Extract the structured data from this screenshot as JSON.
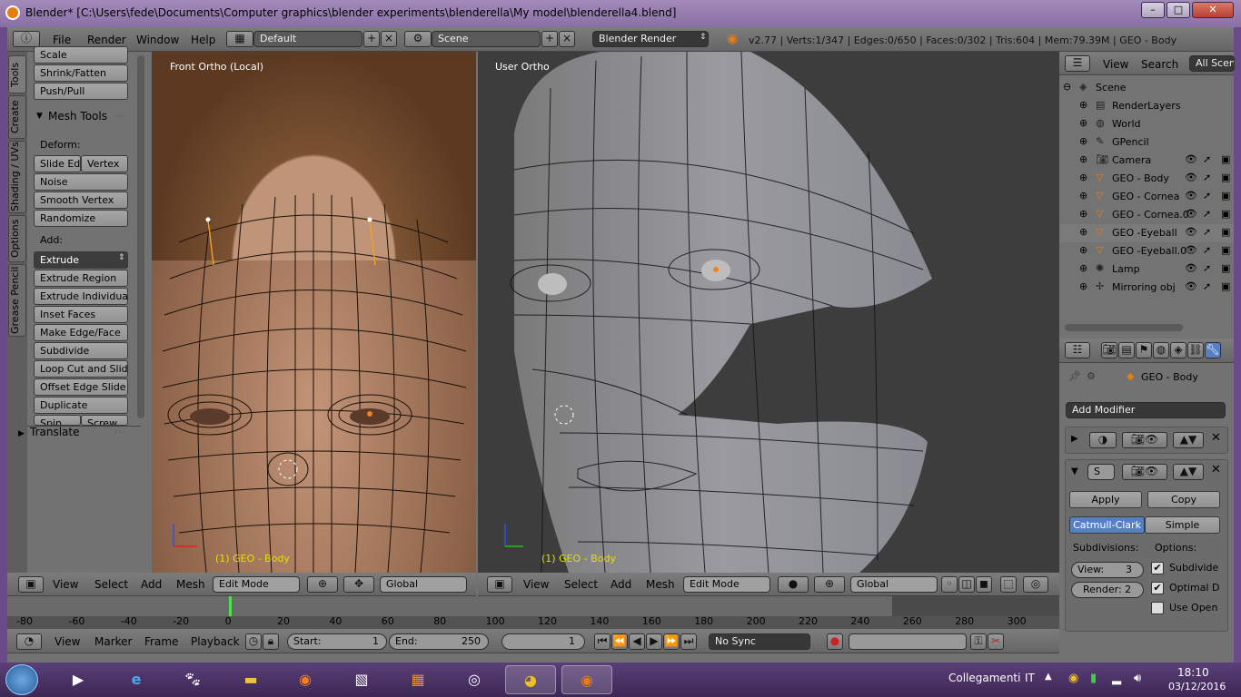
{
  "window": {
    "title": "Blender* [C:\\Users\\fede\\Documents\\Computer graphics\\blender experiments\\blenderella\\My model\\blenderella4.blend]",
    "controls": [
      "–",
      "□",
      "✕"
    ]
  },
  "topbar": {
    "menus": [
      "File",
      "Render",
      "Window",
      "Help"
    ],
    "layout": "Default",
    "scene": "Scene",
    "engine": "Blender Render",
    "stats": "v2.77 | Verts:1/347 | Edges:0/650 | Faces:0/302 | Tris:604 | Mem:79.39M | GEO - Body"
  },
  "toolshelf": {
    "tabs": [
      "Tools",
      "Create",
      "Shading / UVs",
      "Options",
      "Grease Pencil"
    ],
    "top_buttons": [
      "Scale",
      "Shrink/Fatten",
      "Push/Pull"
    ],
    "panel_title": "Mesh Tools",
    "deform_label": "Deform:",
    "deform": {
      "slide_edge": "Slide Ed",
      "vertex": "Vertex",
      "noise": "Noise",
      "smooth_vertex": "Smooth Vertex",
      "randomize": "Randomize"
    },
    "add_label": "Add:",
    "extrude_select": "Extrude",
    "add_buttons": [
      "Extrude Region",
      "Extrude Individual",
      "Inset Faces",
      "Make Edge/Face",
      "Subdivide",
      "Loop Cut and Slide",
      "Offset Edge Slide",
      "Duplicate"
    ],
    "spin": "Spin",
    "screw": "Screw",
    "operator_panel": "Translate"
  },
  "viewport_left": {
    "label": "Front Ortho (Local)",
    "object_label": "(1) GEO - Body",
    "header": {
      "menus": [
        "View",
        "Select",
        "Add",
        "Mesh"
      ],
      "mode": "Edit Mode",
      "orientation": "Global"
    }
  },
  "viewport_right": {
    "label": "User Ortho",
    "object_label": "(1) GEO - Body",
    "header": {
      "menus": [
        "View",
        "Select",
        "Add",
        "Mesh"
      ],
      "mode": "Edit Mode",
      "orientation": "Global"
    }
  },
  "outliner": {
    "menus": [
      "View",
      "Search"
    ],
    "filter": "All Scene",
    "items": [
      {
        "label": "Scene",
        "icon": "scene-icon",
        "depth": 0
      },
      {
        "label": "RenderLayers",
        "icon": "renderlayers-icon",
        "depth": 1
      },
      {
        "label": "World",
        "icon": "world-icon",
        "depth": 1
      },
      {
        "label": "GPencil",
        "icon": "gpencil-icon",
        "depth": 1
      },
      {
        "label": "Camera",
        "icon": "camera-icon",
        "depth": 1
      },
      {
        "label": "GEO - Body",
        "icon": "mesh-icon",
        "depth": 1
      },
      {
        "label": "GEO - Cornea",
        "icon": "mesh-icon",
        "depth": 1
      },
      {
        "label": "GEO - Cornea.0",
        "icon": "mesh-icon",
        "depth": 1
      },
      {
        "label": "GEO -Eyeball",
        "icon": "mesh-icon",
        "depth": 1
      },
      {
        "label": "GEO -Eyeball.0",
        "icon": "mesh-icon",
        "depth": 1
      },
      {
        "label": "Lamp",
        "icon": "lamp-icon",
        "depth": 1
      },
      {
        "label": "Mirroring obj",
        "icon": "empty-icon",
        "depth": 1
      }
    ]
  },
  "properties": {
    "object_name": "GEO - Body",
    "add_modifier": "Add Modifier",
    "modifier2_name": "S",
    "apply": "Apply",
    "copy": "Copy",
    "catmull": "Catmull-Clark",
    "simple": "Simple",
    "subdivisions_label": "Subdivisions:",
    "options_label": "Options:",
    "view_field": "View:",
    "view_value": "3",
    "render_field": "Render: 2",
    "checks": [
      "Subdivide",
      "Optimal D",
      "Use Open"
    ],
    "checks_state": [
      true,
      true,
      false
    ]
  },
  "timeline": {
    "ticks": [
      "-80",
      "-60",
      "-40",
      "-20",
      "0",
      "20",
      "40",
      "60",
      "80",
      "100",
      "120",
      "140",
      "160",
      "180",
      "200",
      "220",
      "240",
      "260",
      "280",
      "300"
    ],
    "menus": [
      "View",
      "Marker",
      "Frame",
      "Playback"
    ],
    "start_label": "Start:",
    "start": "1",
    "end_label": "End:",
    "end": "250",
    "current": "1",
    "sync": "No Sync",
    "current_frame_marker": 0
  },
  "taskbar": {
    "tray_label": "Collegamenti",
    "lang": "IT",
    "time": "18:10",
    "date": "03/12/2016"
  }
}
